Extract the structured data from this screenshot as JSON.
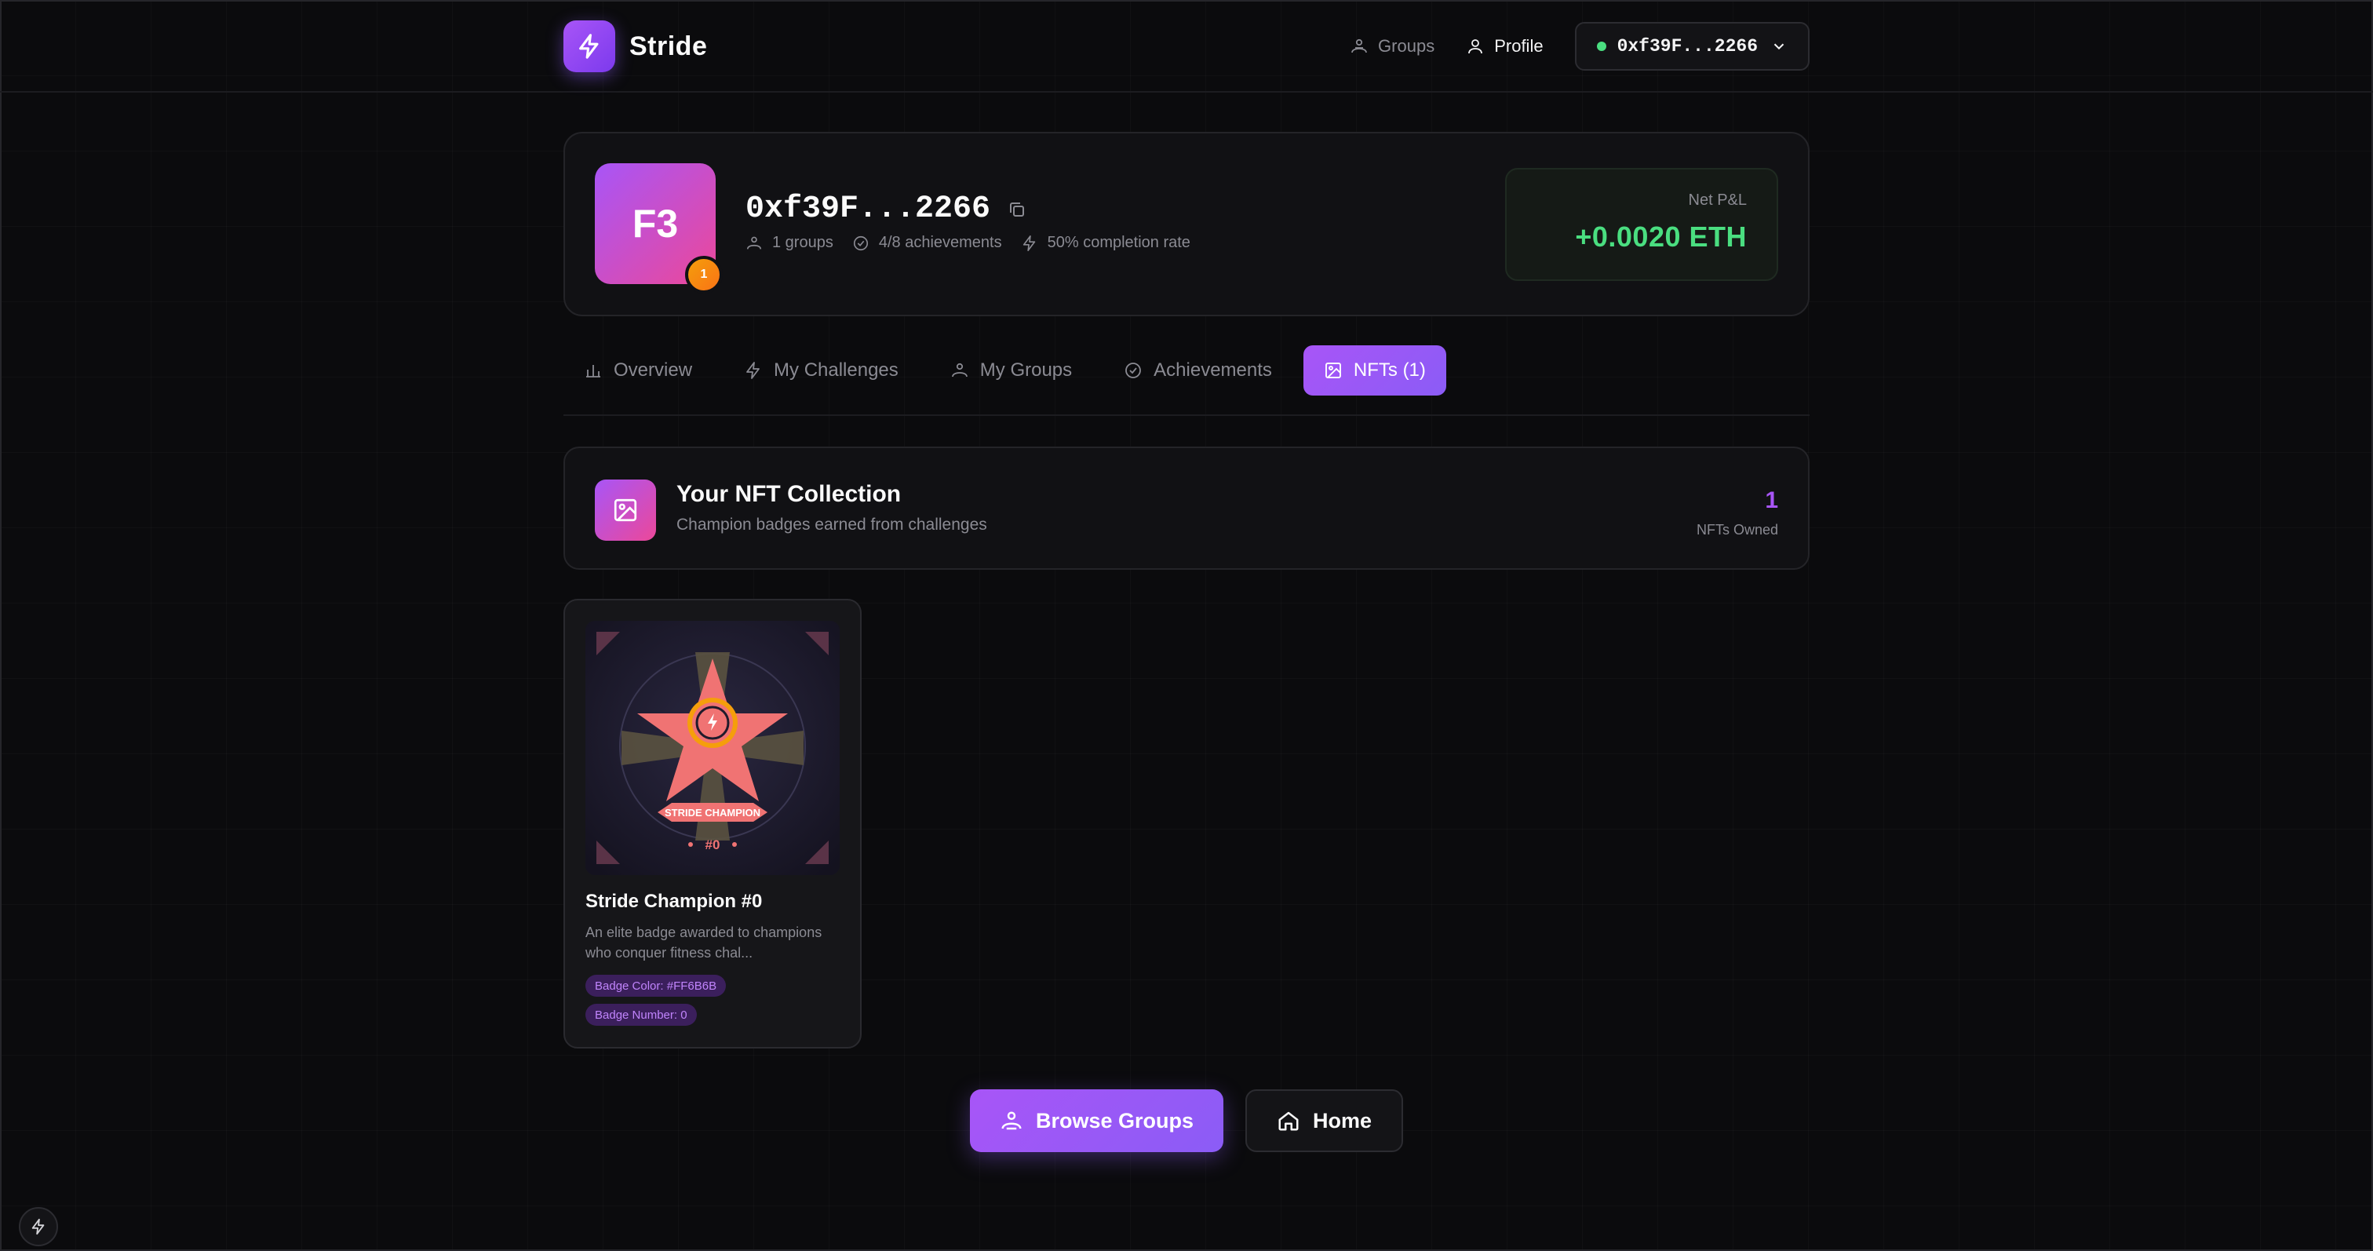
{
  "app": {
    "name": "Stride",
    "brand_color": "#8b5cf6"
  },
  "nav": {
    "groups_label": "Groups",
    "profile_label": "Profile",
    "wallet_address": "0xf39F...2266",
    "wallet_status_color": "#4ade80"
  },
  "profile": {
    "avatar_initials": "F3",
    "level": "1",
    "address": "0xf39F...2266",
    "groups": "1 groups",
    "achievements": "4/8 achievements",
    "completion": "50% completion rate",
    "pnl_label": "Net P&L",
    "pnl_value": "+0.0020 ETH",
    "pnl_color": "#4ade80"
  },
  "tabs": [
    {
      "label": "Overview",
      "icon": "bar-chart-icon"
    },
    {
      "label": "My Challenges",
      "icon": "lightning-icon"
    },
    {
      "label": "My Groups",
      "icon": "users-icon"
    },
    {
      "label": "Achievements",
      "icon": "check-circle-icon"
    },
    {
      "label": "NFTs (1)",
      "icon": "image-icon",
      "active": true
    }
  ],
  "collection": {
    "title": "Your NFT Collection",
    "subtitle": "Champion badges earned from challenges",
    "count": "1",
    "count_label": "NFTs Owned"
  },
  "nfts": [
    {
      "name": "Stride Champion #0",
      "description": "An elite badge awarded to champions who conquer fitness chal...",
      "badge_ribbon": "STRIDE CHAMPION",
      "badge_number_text": "#0",
      "badge_color": "#FF6B6B",
      "attributes": [
        "Badge Color: #FF6B6B",
        "Badge Number: 0"
      ]
    }
  ],
  "actions": {
    "browse_groups": "Browse Groups",
    "home": "Home"
  }
}
